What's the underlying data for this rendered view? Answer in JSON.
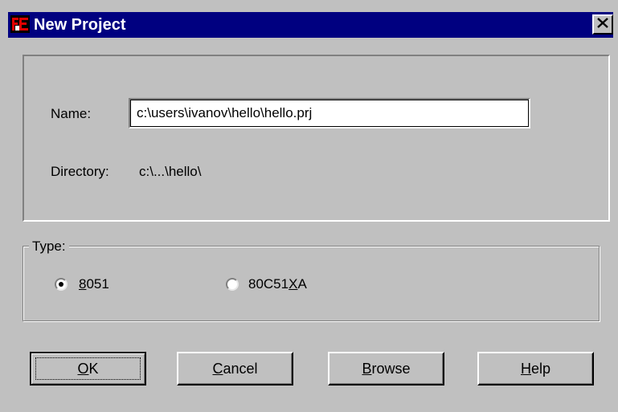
{
  "window": {
    "title": "New Project",
    "title_bar_color": "#000080",
    "background_color": "#c0c0c0",
    "app_icon": "app-logo-icon",
    "close_icon": "close-icon"
  },
  "info": {
    "name_label": "Name:",
    "name_value": "c:\\users\\ivanov\\hello\\hello.prj",
    "directory_label": "Directory:",
    "directory_value": "c:\\...\\hello\\"
  },
  "type_group": {
    "legend": "Type:",
    "options": [
      {
        "mnemonic": "8",
        "rest": "051",
        "label": "8051",
        "selected": true
      },
      {
        "prefix": "80C51",
        "mnemonic": "X",
        "rest": "A",
        "label": "80C51XA",
        "selected": false
      }
    ]
  },
  "buttons": {
    "ok": {
      "mnemonic": "O",
      "rest": "K"
    },
    "cancel": {
      "mnemonic": "C",
      "rest": "ancel"
    },
    "browse": {
      "mnemonic": "B",
      "rest": "rowse"
    },
    "help": {
      "mnemonic": "H",
      "rest": "elp"
    }
  }
}
